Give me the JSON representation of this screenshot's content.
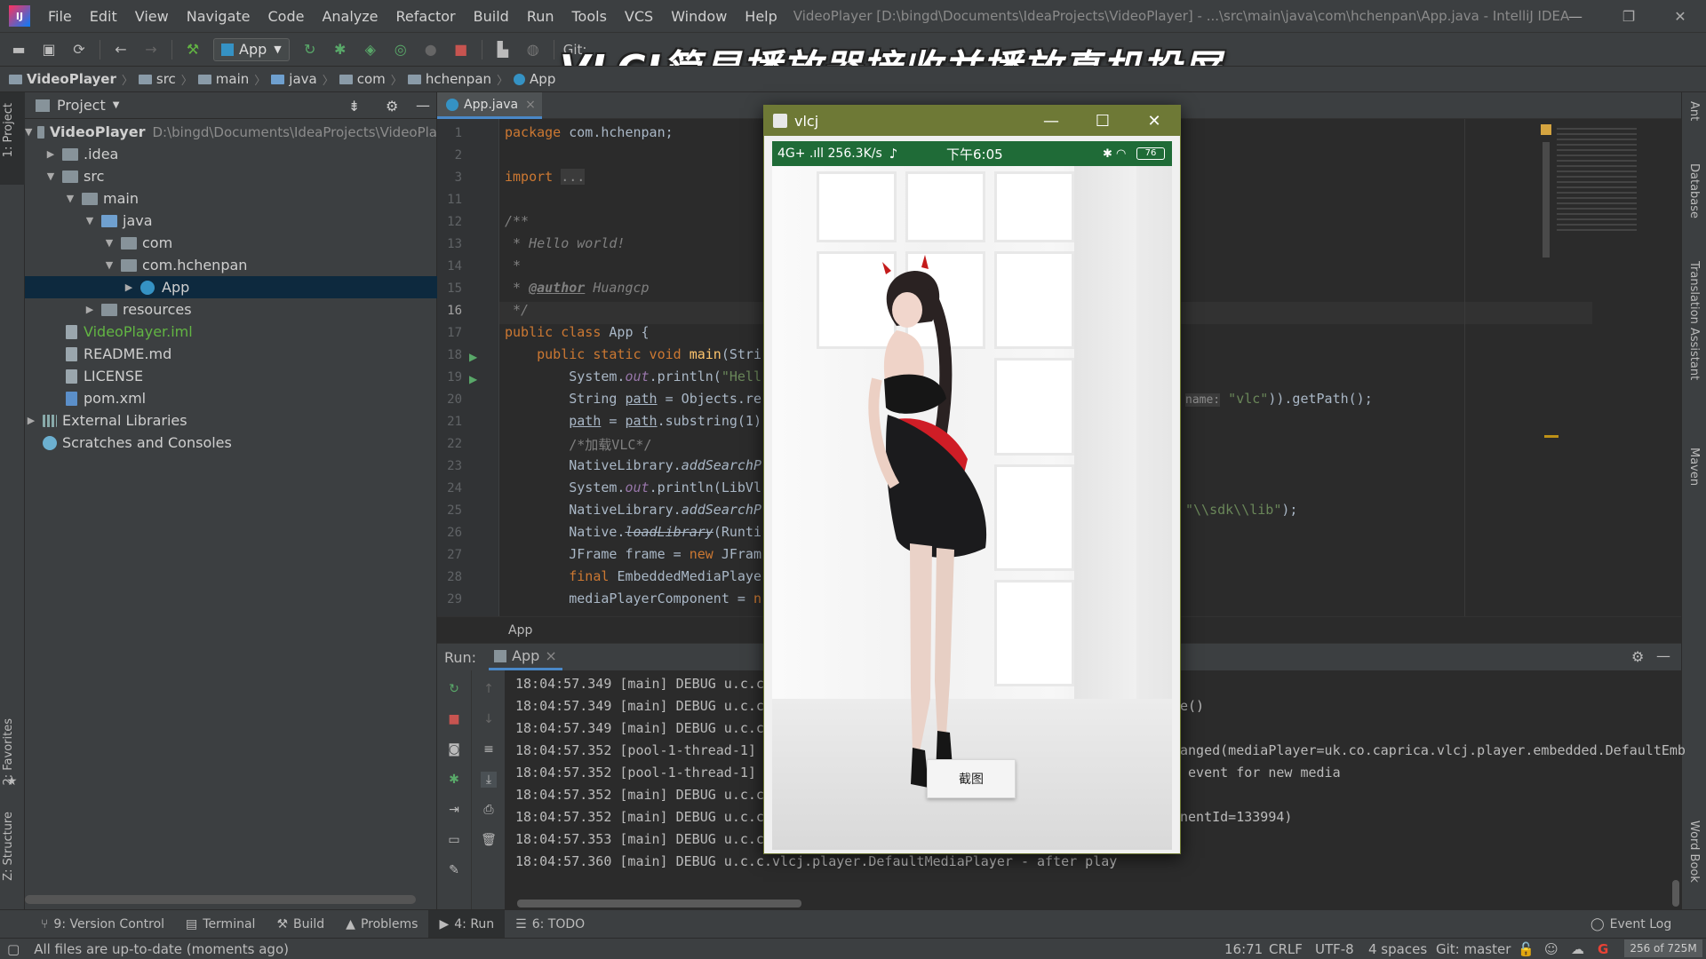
{
  "app_title": "VideoPlayer [D:\\bingd\\Documents\\IdeaProjects\\VideoPlayer] - ...\\src\\main\\java\\com\\hchenpan\\App.java - IntelliJ IDEA",
  "menu": [
    "File",
    "Edit",
    "View",
    "Navigate",
    "Code",
    "Analyze",
    "Refactor",
    "Build",
    "Run",
    "Tools",
    "VCS",
    "Window",
    "Help"
  ],
  "toolbar": {
    "run_config": "App",
    "git_label": "Git:"
  },
  "overlay_title": "VLCJ简易播放器接收并播放真机投屏",
  "breadcrumbs": [
    "VideoPlayer",
    "src",
    "main",
    "java",
    "com",
    "hchenpan",
    "App"
  ],
  "project": {
    "header": "Project",
    "tree": [
      {
        "label": "VideoPlayer",
        "extra": "D:\\bingd\\Documents\\IdeaProjects\\VideoPla"
      },
      {
        "label": ".idea"
      },
      {
        "label": "src"
      },
      {
        "label": "main"
      },
      {
        "label": "java"
      },
      {
        "label": "com"
      },
      {
        "label": "com.hchenpan"
      },
      {
        "label": "App"
      },
      {
        "label": "resources"
      },
      {
        "label": "VideoPlayer.iml"
      },
      {
        "label": "README.md"
      },
      {
        "label": "LICENSE"
      },
      {
        "label": "pom.xml"
      },
      {
        "label": "External Libraries"
      },
      {
        "label": "Scratches and Consoles"
      }
    ]
  },
  "editor": {
    "tab": "App.java",
    "line_numbers": [
      "1",
      "2",
      "3",
      "11",
      "12",
      "13",
      "14",
      "15",
      "16",
      "17",
      "18",
      "19",
      "20",
      "21",
      "22",
      "23",
      "24",
      "25",
      "26",
      "27",
      "28",
      "29"
    ],
    "lines": {
      "l1a": "package ",
      "l1b": "com.hchenpan;",
      "l3a": "import ",
      "l3b": "...",
      "l12": "/**",
      "l13": " * Hello world!",
      "l14": " *",
      "l15a": " * ",
      "l15b": "@author",
      "l15c": " Huangcp",
      "l16": " */",
      "l17a": "public class ",
      "l17b": "App {",
      "l18a": "    public static void ",
      "l18b": "main",
      "l18c": "(Stri",
      "l19a": "        System.",
      "l19b": "out",
      "l19c": ".println(",
      "l19d": "\"Hell",
      "l20a": "        String ",
      "l20b": "path",
      "l20c": " = Objects.re",
      "l20r_hint": "name:",
      "l20r_str": "\"vlc\"",
      "l20r_tail": ")).getPath();",
      "l21a": "        ",
      "l21b": "path",
      "l21c": " = ",
      "l21d": "path",
      ".l21e": "",
      "l21e": ".substring(1)",
      "l22": "        /*加载VLC*/",
      "l23a": "        NativeLibrary.",
      "l23b": "addSearchP",
      "l24a": "        System.",
      "l24b": "out",
      "l24c": ".println(LibVl",
      "l25a": "        NativeLibrary.",
      "l25b": "addSearchP",
      "l25r_str": "\"\\\\sdk\\\\lib\"",
      "l25r_tail": ");",
      "l26a": "        Native.",
      "l26b": "loadLibrary",
      "l26c": "(Runti",
      "l27a": "        JFrame frame = ",
      "l27b": "new ",
      "l27c": "JFram",
      "l28a": "        final ",
      "l28b": "EmbeddedMediaPlaye",
      "l29a": "        mediaPlayerComponent = ",
      "l29b": "n"
    },
    "footer_crumb": "App"
  },
  "run": {
    "label": "Run:",
    "tab": "App",
    "logs": [
      {
        "l": "18:04:57.349 [main] DEBUG u.c.c",
        "r": "e()"
      },
      {
        "l": "18:04:57.349 [main] DEBUG u.c.c",
        "r": ""
      },
      {
        "l": "18:04:57.349 [main] DEBUG u.c.c",
        "r": "anged(mediaPlayer=uk.co.caprica.vlcj.player.embedded.DefaultEmb"
      },
      {
        "l": "18:04:57.352 [pool-1-thread-1]",
        "r": " event for new media"
      },
      {
        "l": "18:04:57.352 [pool-1-thread-1]",
        "r": ""
      },
      {
        "l": "18:04:57.352 [main] DEBUG u.c.c",
        "r": "nentId=133994)"
      },
      {
        "l": "18:04:57.352 [main] DEBUG u.c.c",
        "r": ""
      },
      {
        "l": "18:04:57.353 [main] DEBUG u.c.c",
        "r": ""
      },
      {
        "l": "18:04:57.360 [main] DEBUG u.c.c.vlcj.player.DefaultMediaPlayer - after play",
        "r": ""
      }
    ]
  },
  "bottom_tabs": [
    "9: Version Control",
    "Terminal",
    "Build",
    "Problems",
    "4: Run",
    "6: TODO"
  ],
  "event_log": "Event Log",
  "status": {
    "message": "All files are up-to-date (moments ago)",
    "position": "16:71",
    "line_sep": "CRLF",
    "encoding": "UTF-8",
    "indent": "4 spaces",
    "git": "Git: master",
    "memory": "256 of 725M"
  },
  "left_strip": [
    "1: Project",
    "2: Favorites",
    "Z: Structure"
  ],
  "right_strip": [
    "Ant",
    "Database",
    "Translation Assistant",
    "Maven",
    "Word Book"
  ],
  "vlcj": {
    "title": "vlcj",
    "phone_status_left": "4G+ .ıll 256.3K/s",
    "phone_time": "下午6:05",
    "battery": "76",
    "snapshot_button": "截图"
  },
  "colors": {
    "accent": "#4a88c7",
    "vlcj_titlebar": "#6e7936",
    "phone_statusbar": "#1f6b37"
  }
}
